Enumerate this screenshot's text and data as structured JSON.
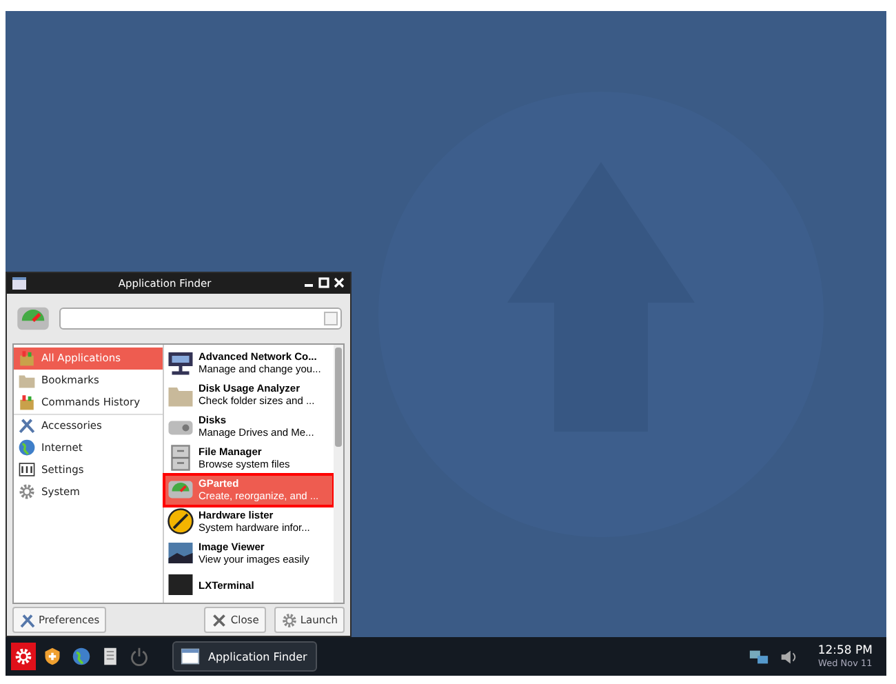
{
  "window": {
    "title": "Application Finder"
  },
  "categories": [
    {
      "label": "All Applications",
      "selected": true
    },
    {
      "label": "Bookmarks",
      "selected": false
    },
    {
      "label": "Commands History",
      "selected": false
    },
    {
      "label": "Accessories",
      "selected": false
    },
    {
      "label": "Internet",
      "selected": false
    },
    {
      "label": "Settings",
      "selected": false
    },
    {
      "label": "System",
      "selected": false
    }
  ],
  "applications": [
    {
      "name": "Advanced Network Co...",
      "description": "Manage and change you...",
      "selected": false,
      "annotated": false
    },
    {
      "name": "Disk Usage Analyzer",
      "description": "Check folder sizes and ...",
      "selected": false,
      "annotated": false
    },
    {
      "name": "Disks",
      "description": "Manage Drives and Me...",
      "selected": false,
      "annotated": false
    },
    {
      "name": "File Manager",
      "description": "Browse system files",
      "selected": false,
      "annotated": false
    },
    {
      "name": "GParted",
      "description": "Create, reorganize, and ...",
      "selected": true,
      "annotated": true
    },
    {
      "name": "Hardware lister",
      "description": "System hardware infor...",
      "selected": false,
      "annotated": false
    },
    {
      "name": "Image Viewer",
      "description": "View your images easily",
      "selected": false,
      "annotated": false
    },
    {
      "name": "LXTerminal",
      "selected": false,
      "annotated": false
    }
  ],
  "buttons": [
    {
      "label": "Preferences"
    },
    {
      "label": "Close"
    },
    {
      "label": "Launch"
    }
  ],
  "taskbar": {
    "launchers": [
      {
        "annotated": true
      },
      {
        "annotated": false
      },
      {
        "annotated": false
      },
      {
        "annotated": false
      },
      {
        "annotated": false
      }
    ],
    "task": {
      "label": "Application Finder"
    },
    "clock": {
      "time": "12:58 PM",
      "date": "Wed Nov 11"
    }
  }
}
